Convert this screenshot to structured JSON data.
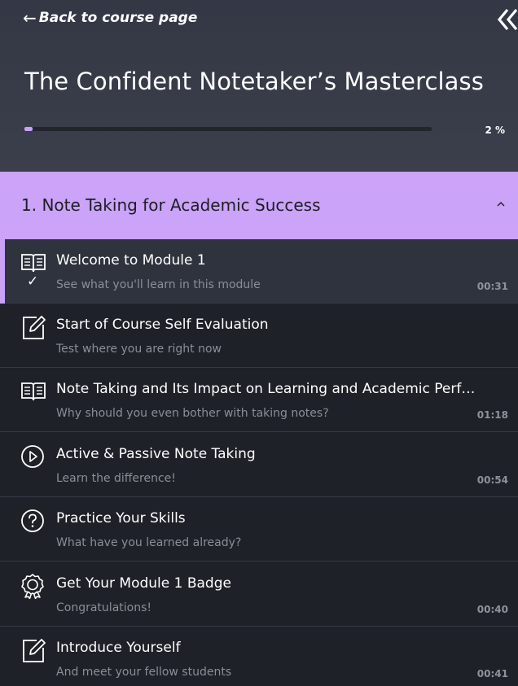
{
  "header": {
    "back_arrow": "←",
    "back_label": "Back to course page",
    "collapse_icon": "double-chevron-left-icon",
    "course_title": "The Confident Notetaker’s Masterclass",
    "progress_percent": 2,
    "progress_text": "2 %"
  },
  "module": {
    "title": "1. Note Taking for Academic Success",
    "expanded": true
  },
  "lessons": [
    {
      "icon": "book-icon",
      "title": "Welcome to Module 1",
      "subtitle": "See what you'll learn in this module",
      "duration": "00:31",
      "completed_mark": "✓",
      "active": true
    },
    {
      "icon": "edit-icon",
      "title": "Start of Course Self Evaluation",
      "subtitle": "Test where you are right now",
      "duration": ""
    },
    {
      "icon": "book-icon",
      "title": "Note Taking and Its Impact on Learning and Academic Perform...",
      "subtitle": "Why should you even bother with taking notes?",
      "duration": "01:18"
    },
    {
      "icon": "play-circle-icon",
      "title": "Active & Passive Note Taking",
      "subtitle": "Learn the difference!",
      "duration": "00:54"
    },
    {
      "icon": "question-circle-icon",
      "title": "Practice Your Skills",
      "subtitle": "What have you learned already?",
      "duration": ""
    },
    {
      "icon": "badge-icon",
      "title": "Get Your Module 1 Badge",
      "subtitle": "Congratulations!",
      "duration": "00:40"
    },
    {
      "icon": "edit-icon",
      "title": "Introduce Yourself",
      "subtitle": "And meet your fellow students",
      "duration": "00:41"
    }
  ],
  "colors": {
    "accent": "#cba3f8",
    "header_bg": "#383c48",
    "list_bg": "#1f2128",
    "active_row_bg": "#2f333d"
  }
}
